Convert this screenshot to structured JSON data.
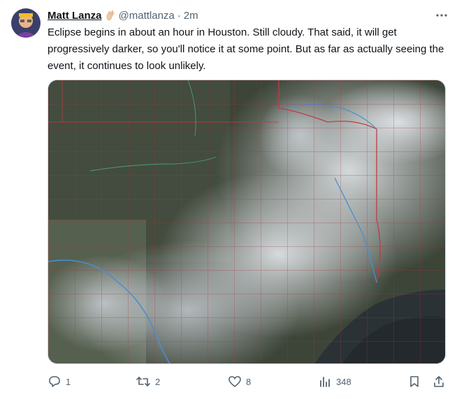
{
  "tweet": {
    "author_name": "Matt Lanza",
    "author_emoji": "waving-hand-icon",
    "handle": "@mattlanza",
    "separator": "·",
    "time": "2m",
    "text": "Eclipse begins in about an hour in Houston. Still cloudy. That said, it will get progressively darker, so you'll notice it at some point. But as far as actually seeing the event, it continues to look unlikely.",
    "media_icon": "satellite-image-texas-map"
  },
  "actions": {
    "reply_count": "1",
    "retweet_count": "2",
    "like_count": "8",
    "views_count": "348"
  },
  "colors": {
    "text_primary": "#0f1419",
    "text_secondary": "#536471",
    "border": "#cfd9de"
  }
}
